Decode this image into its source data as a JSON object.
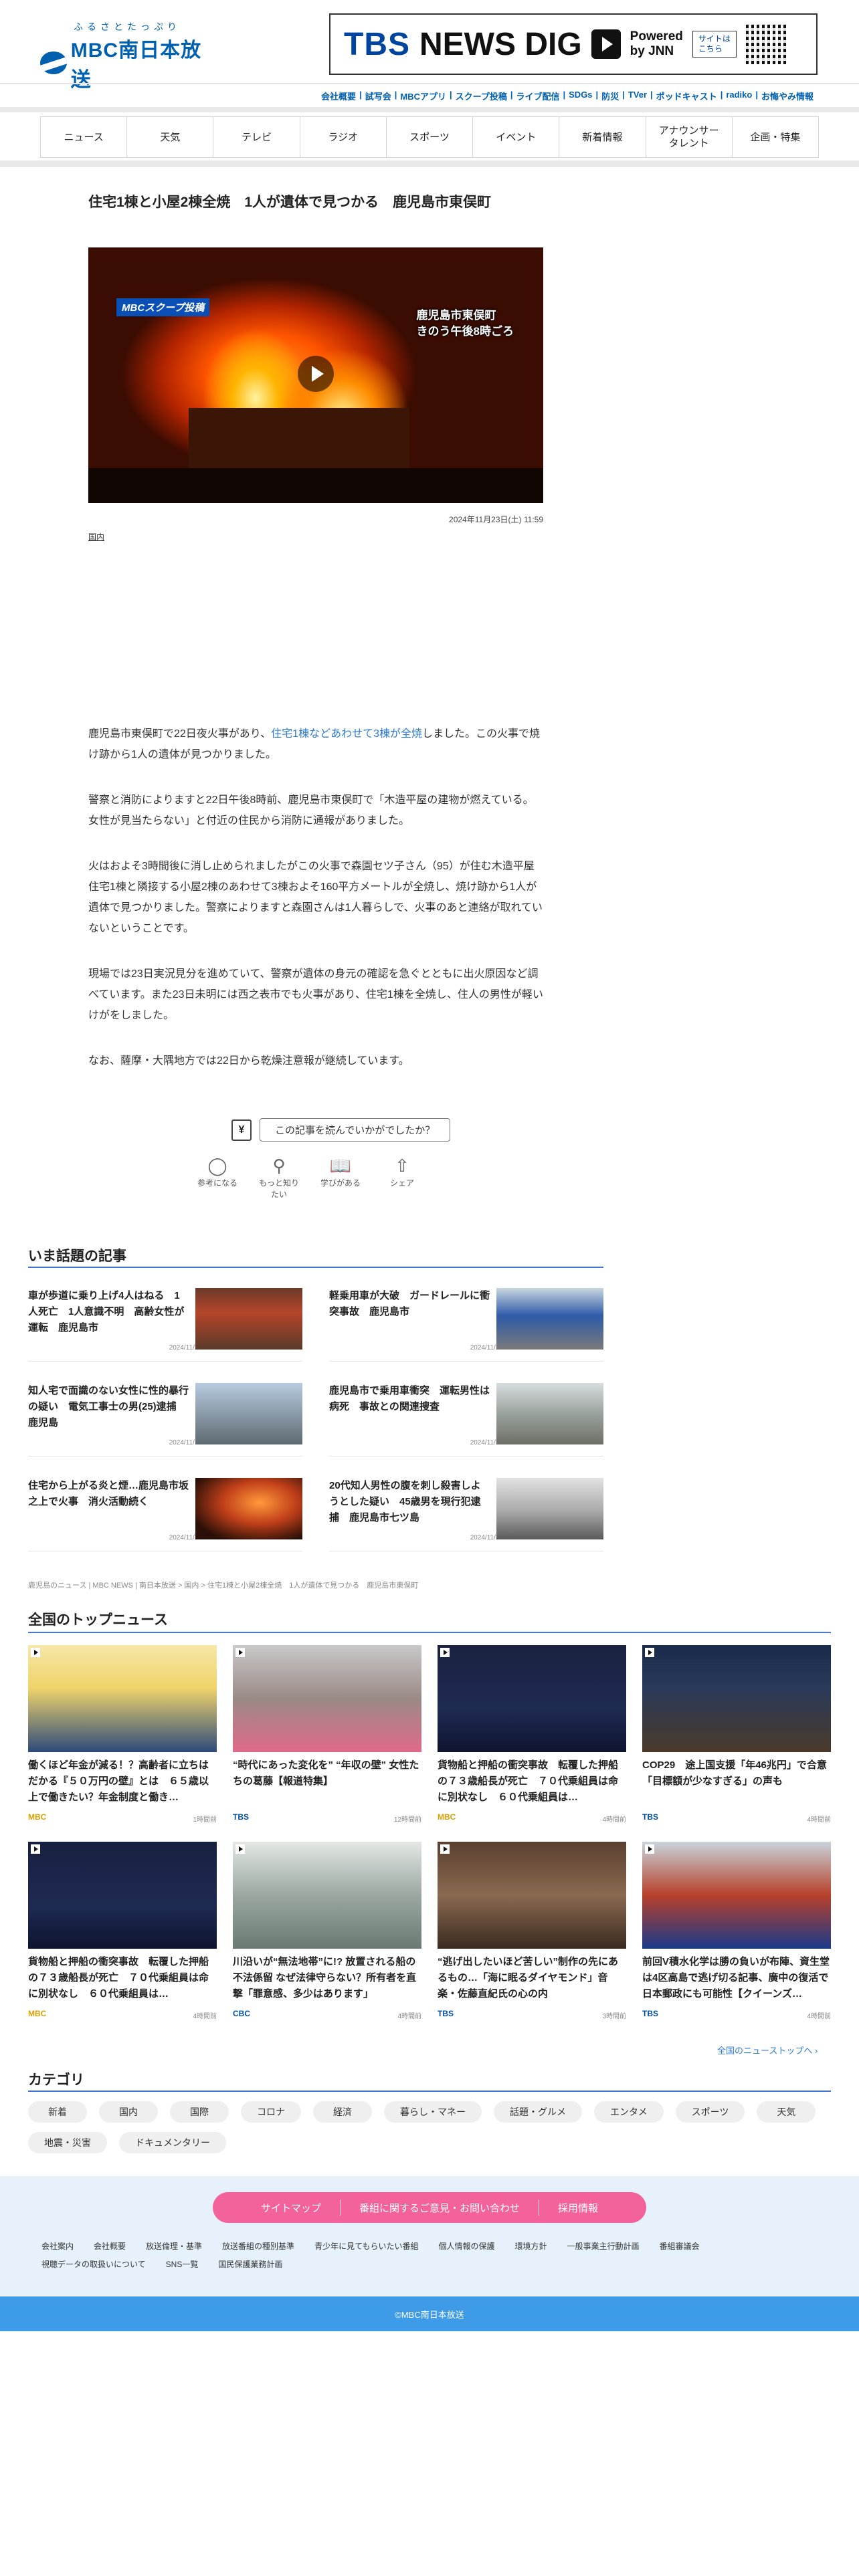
{
  "header": {
    "logo_kana": "ふるさとたっぷり",
    "logo_name": "MBC南日本放送",
    "banner": {
      "tbs": "TBS",
      "dig": "NEWS DIG",
      "powered": "Powered\nby JNN",
      "site": "サイトは\nこちら"
    },
    "toplinks": [
      "会社概要",
      "試写会",
      "MBCアプリ",
      "スクープ投稿",
      "ライブ配信",
      "SDGs",
      "防災",
      "TVer",
      "ポッドキャスト",
      "radiko",
      "お悔やみ情報"
    ]
  },
  "gnav": [
    "ニュース",
    "天気",
    "テレビ",
    "ラジオ",
    "スポーツ",
    "イベント",
    "新着情報",
    "アナウンサー\nタレント",
    "企画・特集"
  ],
  "article": {
    "title": "住宅1棟と小屋2棟全焼　1人が遺体で見つかる　鹿児島市東俣町",
    "video_tag": "MBCスクープ投稿",
    "video_location": "鹿児島市東俣町\nきのう午後8時ごろ",
    "date": "2024年11月23日(土) 11:59",
    "category": "国内",
    "p1_pre": "鹿児島市東俣町で22日夜火事があり、",
    "p1_link": "住宅1棟などあわせて3棟が全焼",
    "p1_post": "しました。この火事で焼け跡から1人の遺体が見つかりました。",
    "p2": "警察と消防によりますと22日午後8時前、鹿児島市東俣町で「木造平屋の建物が燃えている。女性が見当たらない」と付近の住民から消防に通報がありました。",
    "p3": "火はおよそ3時間後に消し止められましたがこの火事で森園セツ子さん（95）が住む木造平屋住宅1棟と隣接する小屋2棟のあわせて3棟およそ160平方メートルが全焼し、焼け跡から1人が遺体で見つかりました。警察によりますと森園さんは1人暮らしで、火事のあと連絡が取れていないということです。",
    "p4": "現場では23日実況見分を進めていて、警察が遺体の身元の確認を急ぐとともに出火原因など調べています。また23日未明には西之表市でも火事があり、住宅1棟を全焼し、住人の男性が軽いけがをしました。",
    "p5": "なお、薩摩・大隅地方では22日から乾燥注意報が継続しています。",
    "feedback_button": "この記事を読んでいかがでしたか？",
    "reactions": [
      "参考になる",
      "もっと知りたい",
      "学びがある",
      "シェア"
    ]
  },
  "trending": {
    "title": "いま話題の記事",
    "items": [
      {
        "title": "車が歩道に乗り上げ4人はねる　1人死亡　1人意識不明　高齢女性が運転　鹿児島市",
        "date": "2024/11/21"
      },
      {
        "title": "軽乗用車が大破　ガードレールに衝突事故　鹿児島市",
        "date": "2024/11/23"
      },
      {
        "title": "知人宅で面識のない女性に性的暴行の疑い　電気工事士の男(25)逮捕　鹿児島",
        "date": "2024/11/14"
      },
      {
        "title": "鹿児島市で乗用車衝突　運転男性は病死　事故との関連捜査",
        "date": "2024/11/21"
      },
      {
        "title": "住宅から上がる炎と煙…鹿児島市坂之上で火事　消火活動続く",
        "date": "2024/11/21"
      },
      {
        "title": "20代知人男性の腹を刺し殺害しようとした疑い　45歳男を現行犯逮捕　鹿児島市七ツ島",
        "date": "2024/11/22"
      }
    ]
  },
  "breadcrumb": "鹿児島のニュース | MBC NEWS | 南日本放送 > 国内 > 住宅1棟と小屋2棟全焼　1人が遺体で見つかる　鹿児島市東俣町",
  "national": {
    "title": "全国のトップニュース",
    "items": [
      {
        "title": "働くほど年金が減る！？高齢者に立ちはだかる『５０万円の壁』とは　６５歳以上で働きたい？年金制度と働き…",
        "source": "MBC",
        "ago": "1時間前"
      },
      {
        "title": "“時代にあった変化を” “年収の壁” 女性たちの葛藤【報道特集】",
        "source": "TBS",
        "ago": "12時間前"
      },
      {
        "title": "貨物船と押船の衝突事故　転覆した押船の７３歳船長が死亡　７０代乗組員は命に別状なし　６０代乗組員は…",
        "source": "MBC",
        "ago": "4時間前"
      },
      {
        "title": "COP29　途上国支援「年46兆円」で合意　「目標額が少なすぎる」の声も",
        "source": "TBS",
        "ago": "4時間前"
      },
      {
        "title": "貨物船と押船の衝突事故　転覆した押船の７３歳船長が死亡　７０代乗組員は命に別状なし　６０代乗組員は…",
        "source": "MBC",
        "ago": "4時間前"
      },
      {
        "title": "川沿いが“無法地帯”に!? 放置される船の不法係留 なぜ法律守らない？所有者を直撃「罪意感、多少はあります」",
        "source": "CBC",
        "ago": "4時間前"
      },
      {
        "title": "“逃げ出したいほど苦しい”制作の先にあるもの…「海に眠るダイヤモンド」音楽・佐藤直紀氏の心の内",
        "source": "TBS",
        "ago": "3時間前"
      },
      {
        "title": "前回V積水化学は勝の負いが布陣、資生堂は4区高島で逃げ切る記事、廣中の復活で日本郵政にも可能性【クイーンズ…",
        "source": "TBS",
        "ago": "4時間前"
      }
    ],
    "more": "全国のニューストップへ ›"
  },
  "categories": {
    "title": "カテゴリ",
    "chips": [
      "新着",
      "国内",
      "国際",
      "コロナ",
      "経済",
      "暮らし・マネー",
      "話題・グルメ",
      "エンタメ",
      "スポーツ",
      "天気",
      "地震・災害",
      "ドキュメンタリー"
    ]
  },
  "footer": {
    "pill": [
      "サイトマップ",
      "番組に関するご意見・お問い合わせ",
      "採用情報"
    ],
    "links": [
      "会社案内",
      "会社概要",
      "放送倫理・基準",
      "放送番組の種別基準",
      "青少年に見てもらいたい番組",
      "個人情報の保護",
      "環境方針",
      "一般事業主行動計画",
      "番組審議会",
      "視聴データの取扱いについて",
      "SNS一覧",
      "国民保護業務計画"
    ],
    "copyright": "©MBC南日本放送"
  }
}
